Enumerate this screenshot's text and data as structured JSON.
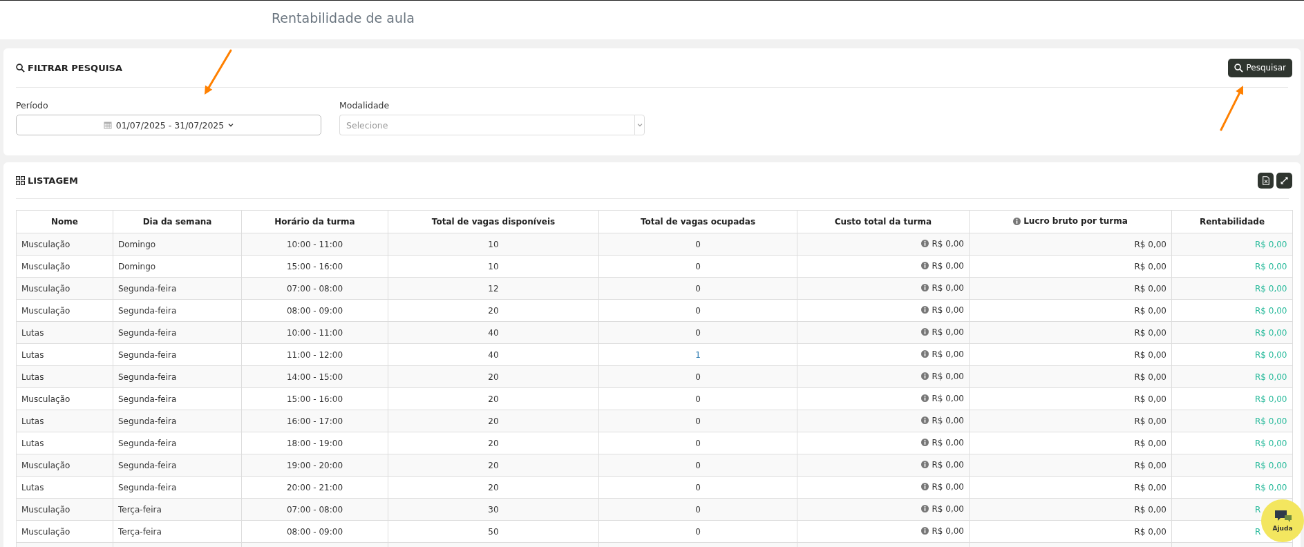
{
  "page": {
    "title": "Rentabilidade de aula"
  },
  "filter": {
    "title": "FILTRAR PESQUISA",
    "search_button": "Pesquisar",
    "period": {
      "label": "Período",
      "value": "01/07/2025 - 31/07/2025"
    },
    "modality": {
      "label": "Modalidade",
      "placeholder": "Selecione"
    }
  },
  "listing": {
    "title": "LISTAGEM",
    "columns": [
      {
        "label": "Nome",
        "info": false
      },
      {
        "label": "Dia da semana",
        "info": false
      },
      {
        "label": "Horário da turma",
        "info": false
      },
      {
        "label": "Total de vagas disponíveis",
        "info": false
      },
      {
        "label": "Total de vagas ocupadas",
        "info": false
      },
      {
        "label": "Custo total da turma",
        "info": false
      },
      {
        "label": "Lucro bruto por turma",
        "info": true
      },
      {
        "label": "Rentabilidade",
        "info": false
      }
    ],
    "rows": [
      {
        "cells": [
          "Musculação",
          "Domingo",
          "10:00 - 11:00",
          "10",
          "0",
          "R$ 0,00",
          "R$ 0,00",
          "R$ 0,00"
        ],
        "occupied_link": false
      },
      {
        "cells": [
          "Musculação",
          "Domingo",
          "15:00 - 16:00",
          "10",
          "0",
          "R$ 0,00",
          "R$ 0,00",
          "R$ 0,00"
        ],
        "occupied_link": false
      },
      {
        "cells": [
          "Musculação",
          "Segunda-feira",
          "07:00 - 08:00",
          "12",
          "0",
          "R$ 0,00",
          "R$ 0,00",
          "R$ 0,00"
        ],
        "occupied_link": false
      },
      {
        "cells": [
          "Musculação",
          "Segunda-feira",
          "08:00 - 09:00",
          "20",
          "0",
          "R$ 0,00",
          "R$ 0,00",
          "R$ 0,00"
        ],
        "occupied_link": false
      },
      {
        "cells": [
          "Lutas",
          "Segunda-feira",
          "10:00 - 11:00",
          "40",
          "0",
          "R$ 0,00",
          "R$ 0,00",
          "R$ 0,00"
        ],
        "occupied_link": false
      },
      {
        "cells": [
          "Lutas",
          "Segunda-feira",
          "11:00 - 12:00",
          "40",
          "1",
          "R$ 0,00",
          "R$ 0,00",
          "R$ 0,00"
        ],
        "occupied_link": true
      },
      {
        "cells": [
          "Lutas",
          "Segunda-feira",
          "14:00 - 15:00",
          "20",
          "0",
          "R$ 0,00",
          "R$ 0,00",
          "R$ 0,00"
        ],
        "occupied_link": false
      },
      {
        "cells": [
          "Musculação",
          "Segunda-feira",
          "15:00 - 16:00",
          "20",
          "0",
          "R$ 0,00",
          "R$ 0,00",
          "R$ 0,00"
        ],
        "occupied_link": false
      },
      {
        "cells": [
          "Lutas",
          "Segunda-feira",
          "16:00 - 17:00",
          "20",
          "0",
          "R$ 0,00",
          "R$ 0,00",
          "R$ 0,00"
        ],
        "occupied_link": false
      },
      {
        "cells": [
          "Lutas",
          "Segunda-feira",
          "18:00 - 19:00",
          "20",
          "0",
          "R$ 0,00",
          "R$ 0,00",
          "R$ 0,00"
        ],
        "occupied_link": false
      },
      {
        "cells": [
          "Musculação",
          "Segunda-feira",
          "19:00 - 20:00",
          "20",
          "0",
          "R$ 0,00",
          "R$ 0,00",
          "R$ 0,00"
        ],
        "occupied_link": false
      },
      {
        "cells": [
          "Lutas",
          "Segunda-feira",
          "20:00 - 21:00",
          "20",
          "0",
          "R$ 0,00",
          "R$ 0,00",
          "R$ 0,00"
        ],
        "occupied_link": false
      },
      {
        "cells": [
          "Musculação",
          "Terça-feira",
          "07:00 - 08:00",
          "30",
          "0",
          "R$ 0,00",
          "R$ 0,00",
          "R"
        ],
        "occupied_link": false
      },
      {
        "cells": [
          "Musculação",
          "Terça-feira",
          "08:00 - 09:00",
          "50",
          "0",
          "R$ 0,00",
          "R$ 0,00",
          "R"
        ],
        "occupied_link": false
      }
    ]
  },
  "help": {
    "label": "Ajuda"
  }
}
